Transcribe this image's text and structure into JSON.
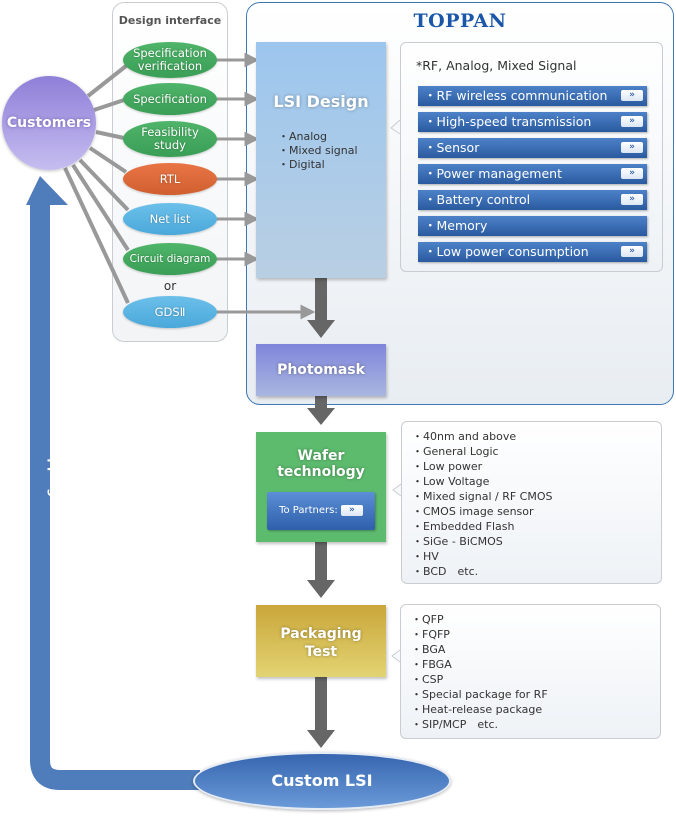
{
  "design_interface": {
    "title": "Design interface",
    "items": [
      {
        "label": "Specification verification",
        "color": "#47ae63"
      },
      {
        "label": "Specification",
        "color": "#47ae63"
      },
      {
        "label": "Feasibility study",
        "color": "#47ae63"
      },
      {
        "label": "RTL",
        "color": "#e06a3a"
      },
      {
        "label": "Net list",
        "color": "#5bb5e2"
      },
      {
        "label": "Circuit diagram",
        "color": "#47ae63"
      },
      {
        "label": "GDSⅡ",
        "color": "#5bb5e2"
      }
    ],
    "or_label": "or"
  },
  "customers": {
    "label": "Customers"
  },
  "toppan": {
    "logo": "TOPPAN"
  },
  "lsi_design": {
    "title": "LSI Design",
    "items": [
      "・Analog",
      "・Mixed signal",
      "・Digital"
    ]
  },
  "rf_panel": {
    "heading": "*RF, Analog, Mixed Signal",
    "items": [
      {
        "label": "・RF wireless communication",
        "has_link": true
      },
      {
        "label": "・High-speed transmission",
        "has_link": true
      },
      {
        "label": "・Sensor",
        "has_link": true
      },
      {
        "label": "・Power management",
        "has_link": true
      },
      {
        "label": "・Battery control",
        "has_link": true
      },
      {
        "label": "・Memory",
        "has_link": false
      },
      {
        "label": "・Low power consumption",
        "has_link": true
      }
    ],
    "link_glyph": "»"
  },
  "photomask": {
    "title": "Photomask"
  },
  "wafer": {
    "title_line1": "Wafer",
    "title_line2": "technology",
    "partners_button": "To Partners:",
    "items": [
      "・40nm and above",
      "・General Logic",
      "・Low power",
      "・Low Voltage",
      "・Mixed signal / RF CMOS",
      "・CMOS image sensor",
      "・Embedded Flash",
      "・SiGe - BiCMOS",
      "・HV",
      "・BCD　etc."
    ]
  },
  "packaging": {
    "title_line1": "Packaging",
    "title_line2": "Test",
    "items": [
      "・QFP",
      "・FQFP",
      "・BGA",
      "・FBGA",
      "・CSP",
      "・Special package for RF",
      "・Heat-release package",
      "・SIP/MCP　etc."
    ]
  },
  "custom_lsi": {
    "label": "Custom LSI"
  },
  "shipping": {
    "label": "Shipping"
  },
  "colors": {
    "toppan_blue": "#1a57a8",
    "shipping_arrow": "#4f7cba",
    "flow_arrow": "#666666",
    "connector": "#999999"
  }
}
